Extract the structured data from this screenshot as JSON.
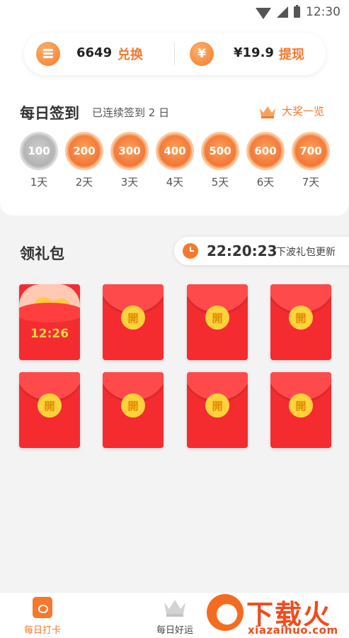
{
  "status_bar": {
    "time": "12:30"
  },
  "balance": {
    "coins": "6649",
    "exchange_label": "兑换",
    "yuan_symbol": "¥",
    "cash": "¥19.9",
    "withdraw_label": "提现"
  },
  "checkin": {
    "title": "每日签到",
    "streak_text": "已连续签到 2 日",
    "prize_label": "大奖一览",
    "days": [
      {
        "amount": "100",
        "label": "1天",
        "claimed": true
      },
      {
        "amount": "200",
        "label": "2天",
        "claimed": false
      },
      {
        "amount": "300",
        "label": "3天",
        "claimed": false
      },
      {
        "amount": "400",
        "label": "4天",
        "claimed": false
      },
      {
        "amount": "500",
        "label": "5天",
        "claimed": false
      },
      {
        "amount": "600",
        "label": "6天",
        "claimed": false
      },
      {
        "amount": "700",
        "label": "7天",
        "claimed": false
      }
    ]
  },
  "gift": {
    "title": "领礼包",
    "countdown": "22:20:23",
    "countdown_label": "下波礼包更新",
    "opened_envelope_time": "12:26",
    "seal_char": "開",
    "coin_char": "¥"
  },
  "bottom_nav": {
    "items": [
      {
        "label": "每日打卡",
        "active": true
      },
      {
        "label": "每日好运",
        "active": false
      }
    ]
  },
  "watermark": {
    "brand": "下载火",
    "url": "xiazaihuo.com"
  },
  "colors": {
    "accent": "#f5782d",
    "envelope": "#f42c30",
    "seal": "#ffd23c"
  }
}
